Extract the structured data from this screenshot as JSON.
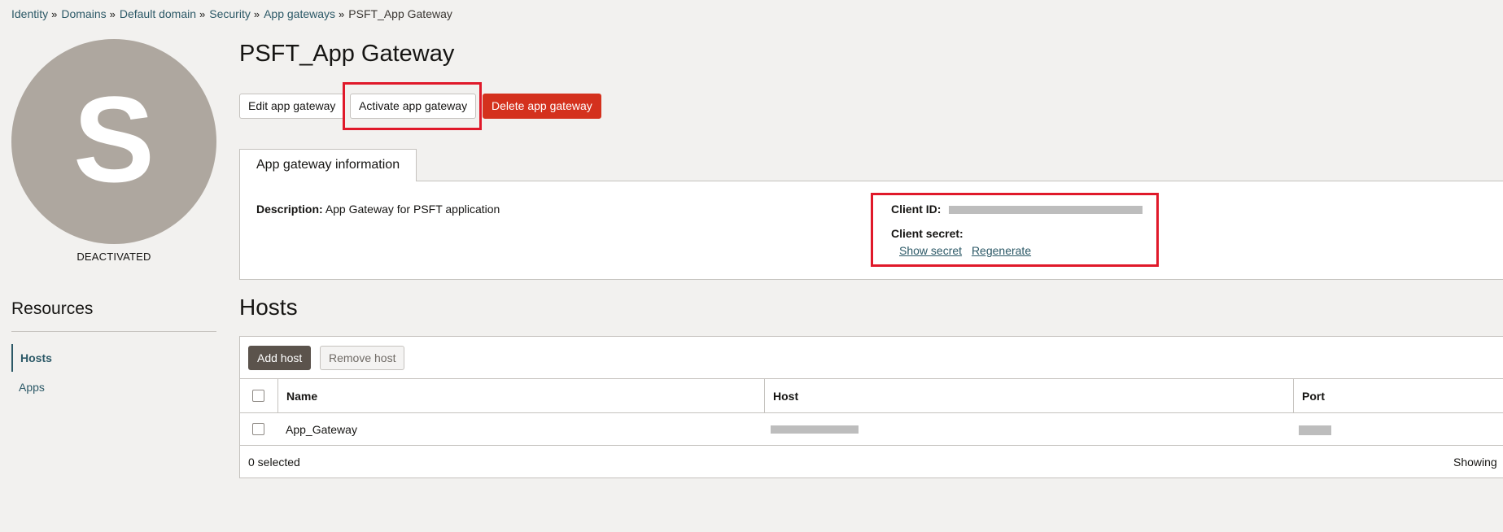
{
  "breadcrumb": {
    "items": [
      "Identity",
      "Domains",
      "Default domain",
      "Security",
      "App gateways"
    ],
    "separator": "»",
    "current": "PSFT_App Gateway"
  },
  "avatar": {
    "letter": "S",
    "color": "#aea79f"
  },
  "status": "DEACTIVATED",
  "resources": {
    "title": "Resources",
    "items": [
      {
        "label": "Hosts",
        "active": true
      },
      {
        "label": "Apps",
        "active": false
      }
    ]
  },
  "page_title": "PSFT_App Gateway",
  "actions": {
    "edit_label": "Edit app gateway",
    "activate_label": "Activate app gateway",
    "delete_label": "Delete app gateway"
  },
  "info": {
    "tab_label": "App gateway information",
    "description_label": "Description:",
    "description_value": "App Gateway for PSFT application",
    "client_id_label": "Client ID:",
    "client_secret_label": "Client secret:",
    "show_secret_label": "Show secret",
    "regenerate_label": "Regenerate"
  },
  "hosts": {
    "title": "Hosts",
    "add_label": "Add host",
    "remove_label": "Remove host",
    "columns": [
      "Name",
      "Host",
      "Port"
    ],
    "rows": [
      {
        "name": "App_Gateway"
      }
    ],
    "selected_text": "0 selected",
    "showing_text": "Showing"
  },
  "colors": {
    "link": "#2c5967",
    "danger": "#d4311d",
    "highlight": "#e0192a",
    "primary_dark": "#5b534c"
  }
}
